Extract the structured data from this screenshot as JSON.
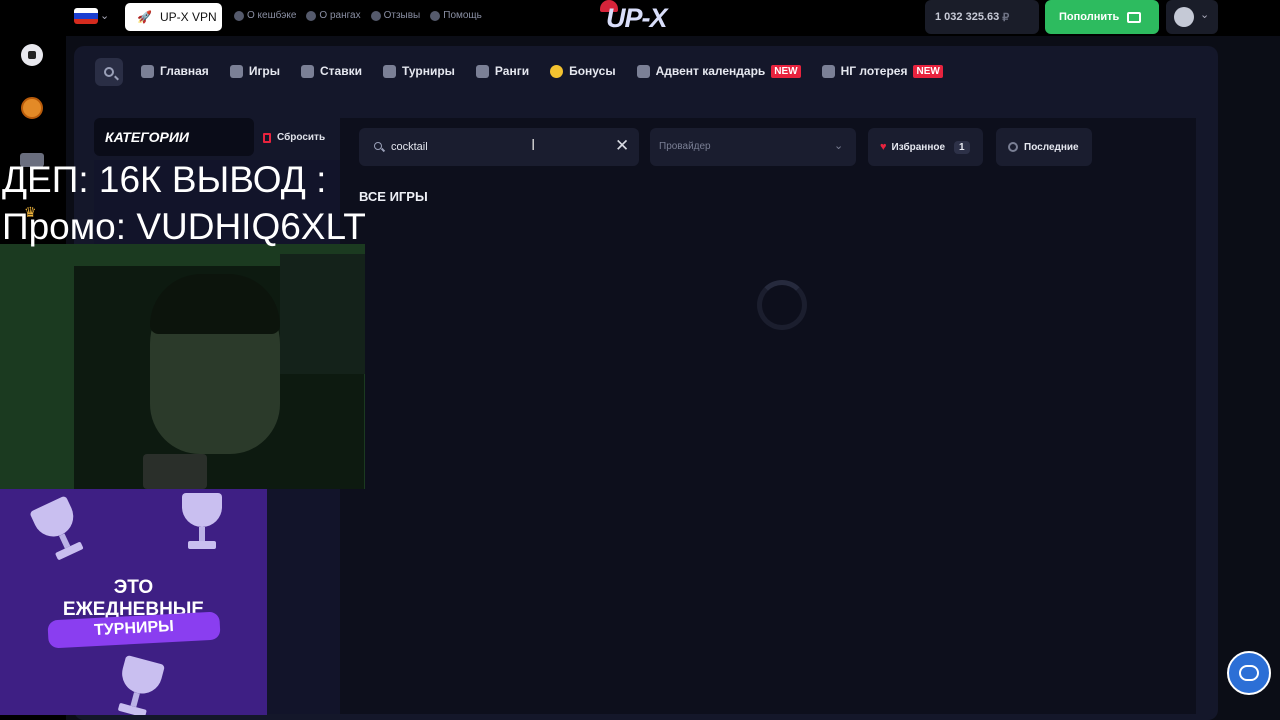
{
  "topbar": {
    "vpn_label": "UP-X VPN",
    "links": [
      "О кешбэке",
      "О рангах",
      "Отзывы",
      "Помощь"
    ],
    "logo": "UP-X",
    "balance": "1 032 325.63",
    "currency": "₽",
    "deposit_label": "Пополнить"
  },
  "nav": {
    "items": [
      {
        "label": "Главная",
        "icon": "grid-icon"
      },
      {
        "label": "Игры",
        "icon": "spade-icon"
      },
      {
        "label": "Ставки",
        "icon": "ball-icon"
      },
      {
        "label": "Турниры",
        "icon": "trophy-icon"
      },
      {
        "label": "Ранги",
        "icon": "medal-icon"
      },
      {
        "label": "Бонусы",
        "icon": "coin-icon"
      },
      {
        "label": "Адвент календарь",
        "icon": "calendar-icon",
        "badge": "NEW"
      },
      {
        "label": "НГ лотерея",
        "icon": "gift-icon",
        "badge": "NEW"
      }
    ]
  },
  "sidebar": {
    "title": "КАТЕГОРИИ",
    "reset_label": "Сбросить"
  },
  "filters": {
    "search_value": "cocktail",
    "provider_placeholder": "Провайдер",
    "favorites_label": "Избранное",
    "favorites_count": "1",
    "recent_label": "Последние"
  },
  "main": {
    "section_title": "ВСЕ ИГРЫ"
  },
  "overlay": {
    "line1": "ДЕП: 16К ВЫВОД :",
    "line2": "Промо: VUDHIQ6XLT"
  },
  "promo": {
    "line1": "ЭТО",
    "line2": "ЕЖЕДНЕВНЫЕ",
    "line3": "ТУРНИРЫ"
  },
  "colors": {
    "accent_green": "#2dbb5f",
    "badge_red": "#e8233e",
    "chat_blue": "#2c6fd6"
  }
}
